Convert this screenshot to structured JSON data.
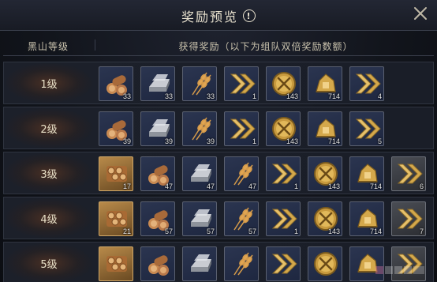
{
  "dialog": {
    "title": "奖励预览",
    "info_icon": "!",
    "close_icon": "close-icon"
  },
  "header": {
    "level_col": "黑山等级",
    "reward_col": "获得奖励（以下为组队双倍奖励数额）"
  },
  "rows": [
    {
      "level": "1级",
      "items": [
        {
          "icon": "wood-logs-icon",
          "count": "33",
          "frame": "blue"
        },
        {
          "icon": "iron-ingot-icon",
          "count": "33",
          "frame": "blue"
        },
        {
          "icon": "wheat-icon",
          "count": "33",
          "frame": "blue"
        },
        {
          "icon": "speed-chevron-icon",
          "count": "1",
          "frame": "blue"
        },
        {
          "icon": "crossed-swords-coin-icon",
          "count": "143",
          "frame": "blue"
        },
        {
          "icon": "gold-chest-icon",
          "count": "714",
          "frame": "blue"
        },
        {
          "icon": "speed-chevron-icon",
          "count": "4",
          "frame": "blue"
        }
      ]
    },
    {
      "level": "2级",
      "items": [
        {
          "icon": "wood-logs-icon",
          "count": "39",
          "frame": "blue"
        },
        {
          "icon": "iron-ingot-icon",
          "count": "39",
          "frame": "blue"
        },
        {
          "icon": "wheat-icon",
          "count": "39",
          "frame": "blue"
        },
        {
          "icon": "speed-chevron-icon",
          "count": "1",
          "frame": "blue"
        },
        {
          "icon": "crossed-swords-coin-icon",
          "count": "143",
          "frame": "blue"
        },
        {
          "icon": "gold-chest-icon",
          "count": "714",
          "frame": "blue"
        },
        {
          "icon": "speed-chevron-icon",
          "count": "5",
          "frame": "blue"
        }
      ]
    },
    {
      "level": "3级",
      "items": [
        {
          "icon": "timber-bundle-icon",
          "count": "17",
          "frame": "gold"
        },
        {
          "icon": "wood-logs-icon",
          "count": "47",
          "frame": "blue"
        },
        {
          "icon": "iron-ingot-icon",
          "count": "47",
          "frame": "blue"
        },
        {
          "icon": "wheat-icon",
          "count": "47",
          "frame": "blue"
        },
        {
          "icon": "speed-chevron-icon",
          "count": "1",
          "frame": "blue"
        },
        {
          "icon": "crossed-swords-coin-icon",
          "count": "143",
          "frame": "blue"
        },
        {
          "icon": "gold-chest-icon",
          "count": "714",
          "frame": "blue"
        },
        {
          "icon": "speed-chevron-icon",
          "count": "6",
          "frame": "gray"
        }
      ]
    },
    {
      "level": "4级",
      "items": [
        {
          "icon": "timber-bundle-icon",
          "count": "21",
          "frame": "gold"
        },
        {
          "icon": "wood-logs-icon",
          "count": "57",
          "frame": "blue"
        },
        {
          "icon": "iron-ingot-icon",
          "count": "57",
          "frame": "blue"
        },
        {
          "icon": "wheat-icon",
          "count": "57",
          "frame": "blue"
        },
        {
          "icon": "speed-chevron-icon",
          "count": "1",
          "frame": "blue"
        },
        {
          "icon": "crossed-swords-coin-icon",
          "count": "143",
          "frame": "blue"
        },
        {
          "icon": "gold-chest-icon",
          "count": "714",
          "frame": "blue"
        },
        {
          "icon": "speed-chevron-icon",
          "count": "7",
          "frame": "gray"
        }
      ]
    },
    {
      "level": "5级",
      "items": [
        {
          "icon": "timber-bundle-icon",
          "count": "",
          "frame": "gold"
        },
        {
          "icon": "wood-logs-icon",
          "count": "",
          "frame": "blue"
        },
        {
          "icon": "iron-ingot-icon",
          "count": "",
          "frame": "blue"
        },
        {
          "icon": "wheat-icon",
          "count": "",
          "frame": "blue"
        },
        {
          "icon": "speed-chevron-icon",
          "count": "",
          "frame": "blue"
        },
        {
          "icon": "crossed-swords-coin-icon",
          "count": "",
          "frame": "blue"
        },
        {
          "icon": "gold-chest-icon",
          "count": "",
          "frame": "blue"
        },
        {
          "icon": "speed-chevron-icon",
          "count": "",
          "frame": "gray"
        }
      ]
    }
  ],
  "colors": {
    "accent_gold": "#d4a84b",
    "text_light": "#e8e0c8"
  }
}
